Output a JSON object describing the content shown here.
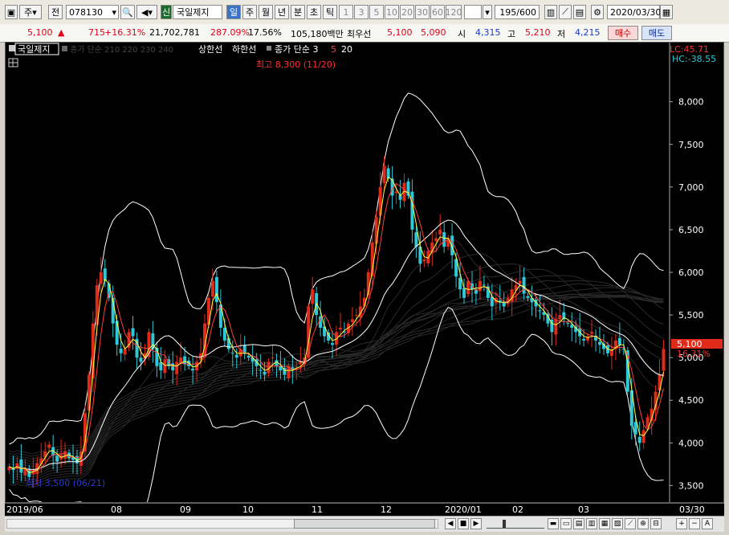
{
  "toolbar": {
    "period_label": "주",
    "prev_label": "전",
    "code": "078130",
    "badge": "신",
    "stock_name": "국일제지",
    "periods": [
      "일",
      "주",
      "월",
      "년"
    ],
    "ticks": [
      "분",
      "초",
      "틱"
    ],
    "intervals": [
      "1",
      "3",
      "5",
      "10",
      "20",
      "30",
      "60",
      "120"
    ],
    "count": "195",
    "count_total": "/600",
    "date": "2020/03/30"
  },
  "quote": {
    "price": "5,100",
    "change": "715",
    "change_pct": "+16.31%",
    "volume": "21,702,781",
    "volume_ratio": "287.09%",
    "turnover": "17.56%",
    "amount": "105,180백만",
    "prefer_label": "최우선",
    "ask": "5,100",
    "bid": "5,090",
    "open_label": "시",
    "open": "4,315",
    "high_label": "고",
    "high": "5,210",
    "low_label": "저",
    "low": "4,215",
    "buy_label": "매수",
    "sell_label": "매도"
  },
  "legend": {
    "name": "국일제지",
    "ma_faded": "종가 단순 210 220 230 240",
    "upper_limit": "상한선",
    "lower_limit": "하한선",
    "ma_label": "종가 단순 3",
    "ma5": "5",
    "ma20": "20"
  },
  "annotations": {
    "high": "최고 8,300 (11/20)",
    "low": "최저 3,500 (06/21)",
    "lc": "LC:45.71",
    "hc": "HC:-38.55",
    "last_price": "5,100",
    "last_pct": "16.31%"
  },
  "colors": {
    "background": "#000000",
    "up": "#e02a1a",
    "down": "#2ec8d8",
    "ma3": "#ffff40",
    "ma5": "#ff4040",
    "ma20": "#ffffff",
    "envelope": "#ffffff"
  },
  "chart_data": {
    "type": "candlestick",
    "ylim": [
      3400,
      8600
    ],
    "yticks": [
      "3,500",
      "4,000",
      "4,500",
      "5,000",
      "5,500",
      "6,000",
      "6,500",
      "7,000",
      "7,500",
      "8,000"
    ],
    "xticks": [
      "2019/06",
      "08",
      "09",
      "10",
      "11",
      "12",
      "2020/01",
      "02",
      "03",
      "03/30"
    ],
    "closes": [
      3720,
      3680,
      3760,
      3650,
      3700,
      3600,
      3680,
      3760,
      3820,
      3900,
      3980,
      3850,
      3780,
      3860,
      3900,
      3820,
      3800,
      3760,
      3900,
      4350,
      4800,
      5400,
      5850,
      6000,
      5900,
      5700,
      5400,
      5150,
      5050,
      5100,
      5300,
      5250,
      5000,
      4950,
      5050,
      5300,
      5100,
      4900,
      4850,
      4980,
      4900,
      4850,
      4950,
      5000,
      4920,
      4900,
      4850,
      4950,
      5050,
      5400,
      5700,
      5900,
      5650,
      5350,
      5200,
      5100,
      5050,
      5000,
      5100,
      5050,
      5000,
      4950,
      4900,
      4850,
      4800,
      4950,
      5000,
      4900,
      4850,
      4800,
      4900,
      4850,
      4880,
      4950,
      5000,
      5600,
      5800,
      5500,
      5350,
      5250,
      5200,
      5150,
      5300,
      5350,
      5300,
      5400,
      5450,
      5500,
      5600,
      5700,
      6000,
      6350,
      6650,
      7000,
      7250,
      7100,
      6900,
      6950,
      6850,
      7050,
      6900,
      6500,
      6300,
      6100,
      6150,
      6250,
      6350,
      6400,
      6500,
      6300,
      6400,
      6200,
      5950,
      5800,
      5700,
      5900,
      5800,
      5750,
      5900,
      5850,
      5700,
      5600,
      5700,
      5650,
      5600,
      5700,
      5800,
      5850,
      5900,
      5750,
      5700,
      5650,
      5600,
      5550,
      5500,
      5400,
      5300,
      5450,
      5500,
      5450,
      5400,
      5350,
      5300,
      5250,
      5200,
      5250,
      5300,
      5200,
      5150,
      5100,
      5050,
      5100,
      5200,
      5150,
      5100,
      4600,
      4200,
      4100,
      4000,
      4150,
      4300,
      4400,
      4600,
      4800,
      5100
    ],
    "series": [
      {
        "name": "3",
        "color": "#ffff40"
      },
      {
        "name": "5",
        "color": "#ff4040"
      },
      {
        "name": "20",
        "color": "#ffffff"
      }
    ]
  }
}
